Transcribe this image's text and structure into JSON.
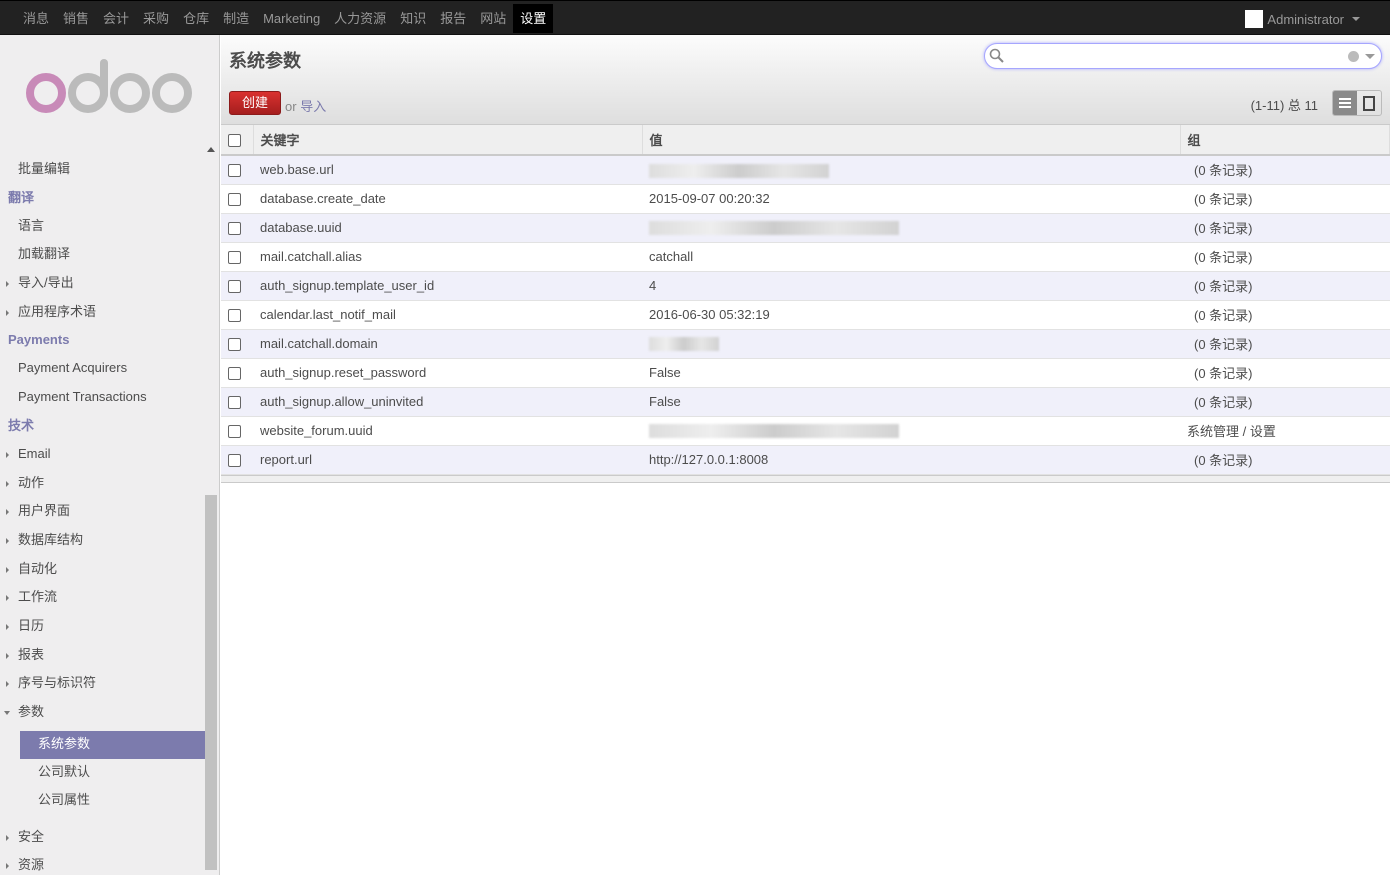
{
  "topbar": {
    "menu": [
      "消息",
      "销售",
      "会计",
      "采购",
      "仓库",
      "制造",
      "Marketing",
      "人力资源",
      "知识",
      "报告",
      "网站",
      "设置"
    ],
    "active": "设置",
    "user": "Administrator"
  },
  "sidebar": {
    "items": [
      {
        "type": "item",
        "label": "批量编辑"
      },
      {
        "type": "section",
        "label": "翻译"
      },
      {
        "type": "item",
        "label": "语言"
      },
      {
        "type": "item",
        "label": "加载翻译"
      },
      {
        "type": "item",
        "label": "导入/导出",
        "expandable": true
      },
      {
        "type": "item",
        "label": "应用程序术语",
        "expandable": true
      },
      {
        "type": "section",
        "label": "Payments"
      },
      {
        "type": "item",
        "label": "Payment Acquirers"
      },
      {
        "type": "item",
        "label": "Payment Transactions"
      },
      {
        "type": "section",
        "label": "技术"
      },
      {
        "type": "item",
        "label": "Email",
        "expandable": true
      },
      {
        "type": "item",
        "label": "动作",
        "expandable": true
      },
      {
        "type": "item",
        "label": "用户界面",
        "expandable": true
      },
      {
        "type": "item",
        "label": "数据库结构",
        "expandable": true
      },
      {
        "type": "item",
        "label": "自动化",
        "expandable": true
      },
      {
        "type": "item",
        "label": "工作流",
        "expandable": true
      },
      {
        "type": "item",
        "label": "日历",
        "expandable": true
      },
      {
        "type": "item",
        "label": "报表",
        "expandable": true
      },
      {
        "type": "item",
        "label": "序号与标识符",
        "expandable": true
      },
      {
        "type": "item",
        "label": "参数",
        "expanded": true
      },
      {
        "type": "sub",
        "label": "系统参数",
        "active": true
      },
      {
        "type": "sub",
        "label": "公司默认"
      },
      {
        "type": "sub",
        "label": "公司属性"
      },
      {
        "type": "item",
        "label": "安全",
        "expandable": true
      },
      {
        "type": "item",
        "label": "资源",
        "expandable": true
      }
    ]
  },
  "main": {
    "title": "系统参数",
    "create": "创建",
    "or": "or",
    "import": "导入",
    "pager": "(1-11) 总 11",
    "search_placeholder": "",
    "columns": [
      "关键字",
      "值",
      "组"
    ],
    "rows": [
      {
        "key": "web.base.url",
        "value": "",
        "blurred": true,
        "group": "(0 条记录)"
      },
      {
        "key": "database.create_date",
        "value": "2015-09-07 00:20:32",
        "group": "(0 条记录)"
      },
      {
        "key": "database.uuid",
        "value": "",
        "blurred": true,
        "group": "(0 条记录)"
      },
      {
        "key": "mail.catchall.alias",
        "value": "catchall",
        "group": "(0 条记录)"
      },
      {
        "key": "auth_signup.template_user_id",
        "value": "4",
        "group": "(0 条记录)"
      },
      {
        "key": "calendar.last_notif_mail",
        "value": "2016-06-30 05:32:19",
        "group": "(0 条记录)"
      },
      {
        "key": "mail.catchall.domain",
        "value": "",
        "blurred": true,
        "group": "(0 条记录)"
      },
      {
        "key": "auth_signup.reset_password",
        "value": "False",
        "group": "(0 条记录)"
      },
      {
        "key": "auth_signup.allow_uninvited",
        "value": "False",
        "group": "(0 条记录)"
      },
      {
        "key": "website_forum.uuid",
        "value": "",
        "blurred": true,
        "group": "系统管理 / 设置"
      },
      {
        "key": "report.url",
        "value": "http://127.0.0.1:8008",
        "group": "(0 条记录)"
      }
    ]
  },
  "colors": {
    "accent": "#7c7bad",
    "create": "#c42a28",
    "topbar": "#222222"
  }
}
